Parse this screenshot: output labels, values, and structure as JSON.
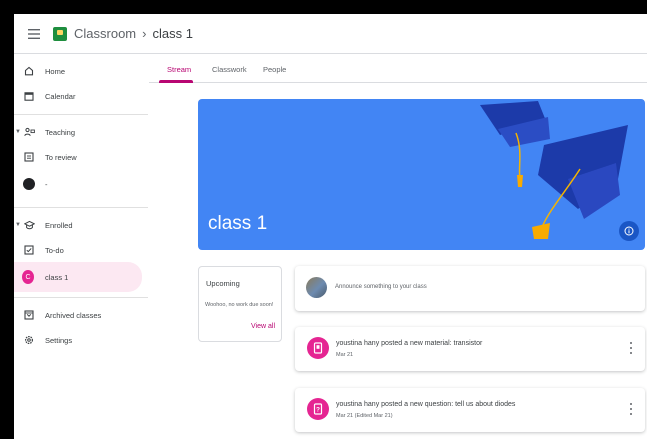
{
  "header": {
    "app_name": "Classroom",
    "separator": "›",
    "class_name": "class 1"
  },
  "sidebar": {
    "items": [
      {
        "label": "Home",
        "icon": "home-icon"
      },
      {
        "label": "Calendar",
        "icon": "calendar-icon"
      },
      {
        "label": "Teaching",
        "icon": "teaching-icon"
      },
      {
        "label": "To review",
        "icon": "review-icon"
      },
      {
        "label": "-",
        "icon": "class-avatar-icon"
      },
      {
        "label": "Enrolled",
        "icon": "enrolled-icon"
      },
      {
        "label": "To-do",
        "icon": "todo-icon"
      },
      {
        "label": "class 1",
        "icon": "class-avatar-icon",
        "avatar_letter": "C"
      },
      {
        "label": "Archived classes",
        "icon": "archive-icon"
      },
      {
        "label": "Settings",
        "icon": "gear-icon"
      }
    ]
  },
  "tabs": [
    {
      "label": "Stream",
      "active": true
    },
    {
      "label": "Classwork",
      "active": false
    },
    {
      "label": "People",
      "active": false
    }
  ],
  "banner": {
    "title": "class 1",
    "color": "#4285f4"
  },
  "upcoming": {
    "title": "Upcoming",
    "message": "Woohoo, no work due soon!",
    "view_all": "View all"
  },
  "announce": {
    "placeholder": "Announce something to your class"
  },
  "posts": [
    {
      "title": "youstina hany posted a new material: transistor",
      "date": "Mar 21",
      "icon": "material-icon"
    },
    {
      "title": "youstina hany posted a new question: tell us about diodes",
      "date": "Mar 21 (Edited Mar 21)",
      "icon": "question-icon"
    }
  ],
  "colors": {
    "accent": "#b80672",
    "avatar": "#e52592",
    "active_nav_bg": "#fce8f2"
  }
}
